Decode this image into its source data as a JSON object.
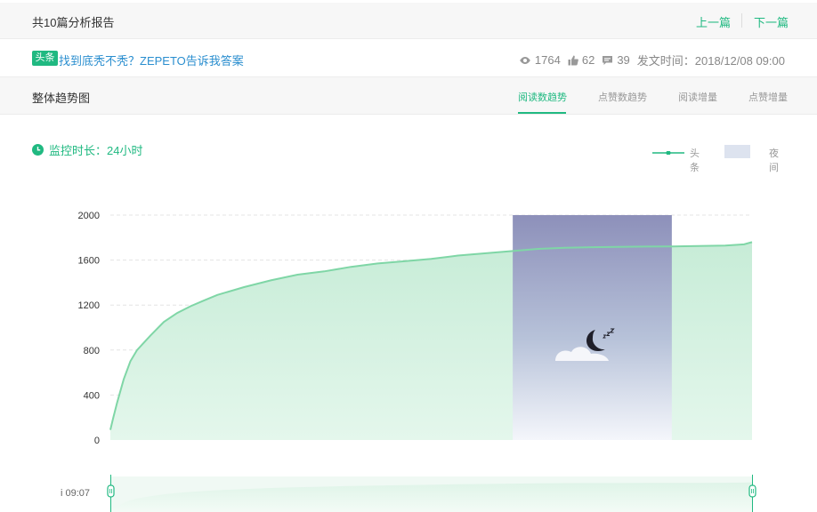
{
  "header": {
    "title": "共10篇分析报告",
    "prev": "上一篇",
    "next": "下一篇"
  },
  "article": {
    "tag": "头条",
    "title": "找到底秃不秃？ZEPETO告诉我答案",
    "views": "1764",
    "likes": "62",
    "comments": "39",
    "publish_time": "发文时间：2018/12/08 09:00"
  },
  "section": {
    "title": "整体趋势图",
    "tabs": [
      "阅读数趋势",
      "点赞数趋势",
      "阅读增量",
      "点赞增量"
    ],
    "active_tab": 0
  },
  "monitor": {
    "text": "监控时长：24小时"
  },
  "legend": {
    "series_label": "头条",
    "night_label": "夜间"
  },
  "colors": {
    "accent": "#20b981",
    "line": "#7fd6a6",
    "area": "#cfeedd",
    "night_top": "#8d90ba"
  },
  "slider": {
    "start_label": "i 09:07"
  },
  "chart_data": {
    "type": "area",
    "ylim": [
      0,
      2000
    ],
    "yticks": [
      0,
      400,
      800,
      1200,
      1600,
      2000
    ],
    "x": [
      0,
      0.1,
      0.25,
      0.5,
      0.75,
      1,
      1.5,
      2,
      2.5,
      3,
      3.5,
      4,
      5,
      6,
      7,
      8,
      9,
      10,
      11,
      12,
      13,
      14,
      15,
      16,
      17,
      18,
      19,
      20,
      21,
      22,
      23,
      23.7,
      24
    ],
    "values": [
      90,
      190,
      330,
      540,
      700,
      800,
      930,
      1050,
      1130,
      1190,
      1240,
      1290,
      1360,
      1420,
      1470,
      1500,
      1540,
      1570,
      1590,
      1610,
      1640,
      1660,
      1680,
      1700,
      1710,
      1715,
      1718,
      1720,
      1722,
      1726,
      1730,
      1740,
      1760
    ],
    "night_band": [
      15.05,
      21
    ],
    "grid": true,
    "legend_position": "top-right"
  }
}
